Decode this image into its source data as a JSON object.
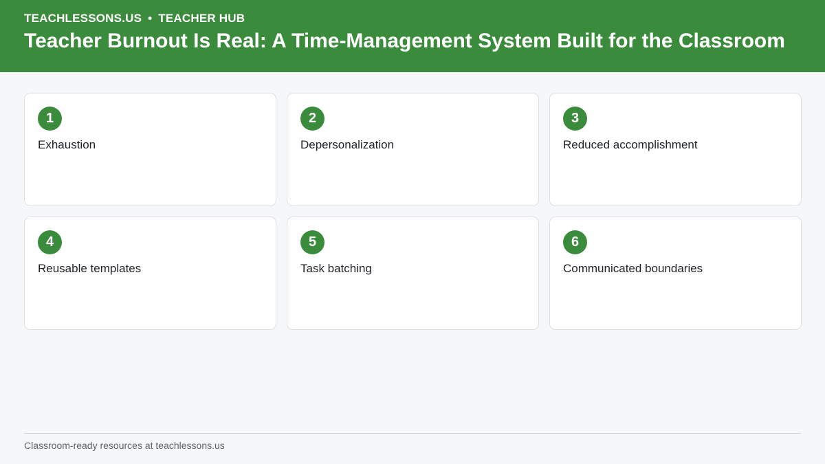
{
  "header": {
    "site": "TEACHLESSONS.US",
    "separator": "•",
    "section": "TEACHER HUB",
    "title": "Teacher Burnout Is Real: A Time-Management System Built for the Classroom"
  },
  "cards": [
    {
      "number": "1",
      "label": "Exhaustion"
    },
    {
      "number": "2",
      "label": "Depersonalization"
    },
    {
      "number": "3",
      "label": "Reduced accomplishment"
    },
    {
      "number": "4",
      "label": "Reusable templates"
    },
    {
      "number": "5",
      "label": "Task batching"
    },
    {
      "number": "6",
      "label": "Communicated boundaries"
    }
  ],
  "footer": {
    "text": "Classroom-ready resources at teachlessons.us"
  },
  "colors": {
    "brand_green": "#3b8b3c",
    "background": "#f6f7f9",
    "card_border": "#dcdfe3"
  }
}
